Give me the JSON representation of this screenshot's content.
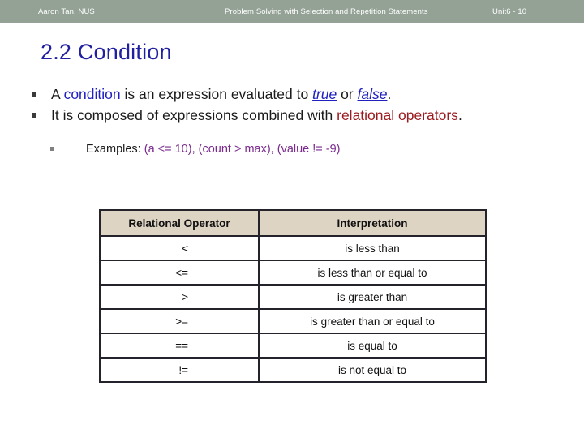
{
  "header": {
    "author": "Aaron Tan, NUS",
    "course": "Problem Solving with Selection and Repetition Statements",
    "unit": "Unit6 - 10",
    "background_color": "#94a296",
    "text_color": "#ffffff"
  },
  "slide": {
    "title": "2.2 Condition",
    "title_color": "#2020a0"
  },
  "bullets": [
    {
      "marker": "square-bullet-icon",
      "segments": [
        {
          "text": "A ",
          "style": "plain"
        },
        {
          "text": "condition",
          "style": "blue"
        },
        {
          "text": " is an expression evaluated to ",
          "style": "plain"
        },
        {
          "text": "true",
          "style": "blue-italic-underline"
        },
        {
          "text": " or ",
          "style": "plain"
        },
        {
          "text": "false",
          "style": "blue-italic-underline"
        },
        {
          "text": ".",
          "style": "plain"
        }
      ]
    },
    {
      "marker": "square-bullet-icon",
      "segments": [
        {
          "text": "It is composed of expressions combined with ",
          "style": "plain"
        },
        {
          "text": "relational operators",
          "style": "red"
        },
        {
          "text": ".",
          "style": "plain"
        }
      ]
    }
  ],
  "sub_bullet": {
    "marker": "square-sub-bullet-icon",
    "segments": [
      {
        "text": "Examples: ",
        "style": "plain"
      },
      {
        "text": "(a <= 10), (count > max), (value != -9)",
        "style": "purple"
      }
    ]
  },
  "colors": {
    "blue": "#2020c0",
    "red": "#9b1b20",
    "purple": "#7b2a8e",
    "table_header_bg": "#ded4c4",
    "table_border": "#24222a"
  },
  "table": {
    "columns": [
      "Relational Operator",
      "Interpretation"
    ],
    "rows": [
      {
        "operator": "<",
        "interpretation": "is less than"
      },
      {
        "operator": "<=",
        "interpretation": "is less than or equal to"
      },
      {
        "operator": ">",
        "interpretation": "is greater than"
      },
      {
        "operator": ">=",
        "interpretation": "is greater than or equal to"
      },
      {
        "operator": "==",
        "interpretation": "is equal to"
      },
      {
        "operator": "!=",
        "interpretation": "is not equal to"
      }
    ]
  }
}
